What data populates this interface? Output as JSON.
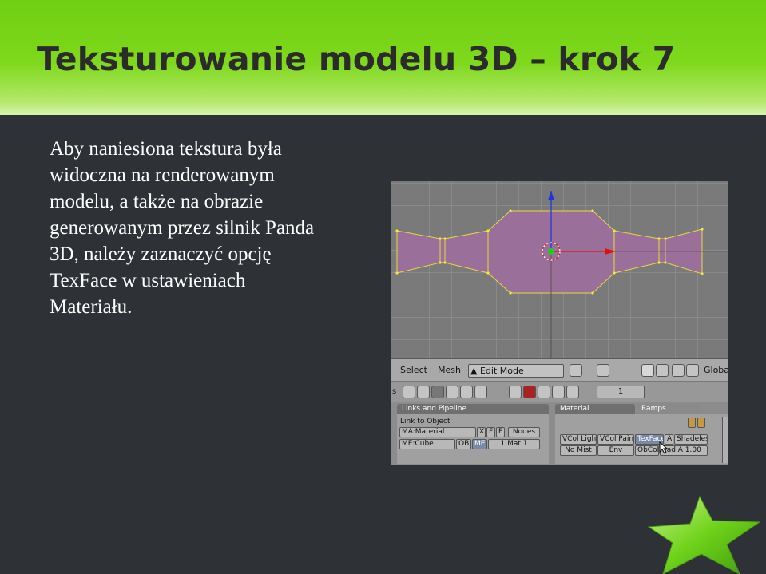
{
  "slide": {
    "title": "Teksturowanie modelu 3D – krok 7",
    "body_lines": [
      " Aby naniesiona tekstura była",
      "widoczna na renderowanym",
      "modelu, a także na obrazie",
      "generowanym przez silnik Panda",
      "3D, należy zaznaczyć opcję",
      "TexFace w ustawieniach",
      "Materiału."
    ]
  },
  "blender": {
    "menu": {
      "select": "Select",
      "mesh": "Mesh"
    },
    "mode": "Edit Mode",
    "orientation": "Globa",
    "layer_count": "1",
    "left_edge_label": "s",
    "links_panel": {
      "tab": "Links and Pipeline",
      "link_to_object": "Link to Object",
      "material_name": "MA:Material",
      "x_btn": "X",
      "f_btn": "F",
      "nodes_btn": "Nodes",
      "mesh_name": "ME:Cube",
      "ob_btn": "OB",
      "me_btn": "ME",
      "mat_count": "1 Mat 1"
    },
    "material_panel": {
      "tab_material": "Material",
      "tab_ramps": "Ramps",
      "row1": [
        "VCol Ligh",
        "VCol Pain",
        "TexFace",
        "A",
        "Shadeles"
      ],
      "row2": [
        "No Mist",
        "Env",
        "ObCol",
        "had A 1.00"
      ]
    }
  },
  "colors": {
    "header_green": "#7fd81c",
    "background": "#2e3236",
    "mesh_fill": "#9a6f9a",
    "mesh_edge": "#e8d840",
    "selected_button": "#7a8aa6"
  }
}
